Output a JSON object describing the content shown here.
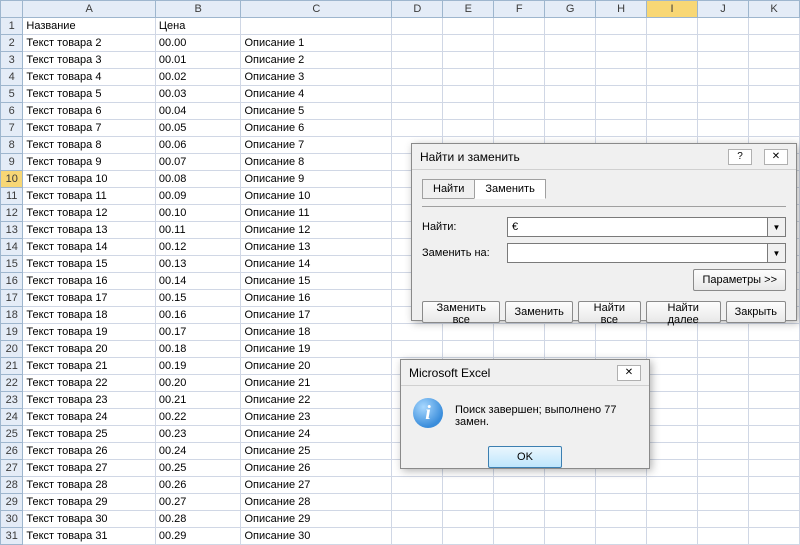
{
  "columns": [
    "A",
    "B",
    "C",
    "D",
    "E",
    "F",
    "G",
    "H",
    "I",
    "J",
    "K"
  ],
  "headers": {
    "A": "Название",
    "B": "Цена",
    "C": ""
  },
  "rows": [
    {
      "n": 1,
      "a": "Название",
      "b": "Цена",
      "c": ""
    },
    {
      "n": 2,
      "a": "Текст товара 2",
      "b": "00.00",
      "c": "Описание 1"
    },
    {
      "n": 3,
      "a": "Текст товара 3",
      "b": "00.01",
      "c": "Описание 2"
    },
    {
      "n": 4,
      "a": "Текст товара 4",
      "b": "00.02",
      "c": "Описание 3"
    },
    {
      "n": 5,
      "a": "Текст товара 5",
      "b": "00.03",
      "c": "Описание 4"
    },
    {
      "n": 6,
      "a": "Текст товара 6",
      "b": "00.04",
      "c": "Описание 5"
    },
    {
      "n": 7,
      "a": "Текст товара 7",
      "b": "00.05",
      "c": "Описание 6"
    },
    {
      "n": 8,
      "a": "Текст товара 8",
      "b": "00.06",
      "c": "Описание 7"
    },
    {
      "n": 9,
      "a": "Текст товара 9",
      "b": "00.07",
      "c": "Описание 8"
    },
    {
      "n": 10,
      "a": "Текст товара 10",
      "b": "00.08",
      "c": "Описание 9"
    },
    {
      "n": 11,
      "a": "Текст товара 11",
      "b": "00.09",
      "c": "Описание 10"
    },
    {
      "n": 12,
      "a": "Текст товара 12",
      "b": "00.10",
      "c": "Описание 11"
    },
    {
      "n": 13,
      "a": "Текст товара 13",
      "b": "00.11",
      "c": "Описание 12"
    },
    {
      "n": 14,
      "a": "Текст товара 14",
      "b": "00.12",
      "c": "Описание 13"
    },
    {
      "n": 15,
      "a": "Текст товара 15",
      "b": "00.13",
      "c": "Описание 14"
    },
    {
      "n": 16,
      "a": "Текст товара 16",
      "b": "00.14",
      "c": "Описание 15"
    },
    {
      "n": 17,
      "a": "Текст товара 17",
      "b": "00.15",
      "c": "Описание 16"
    },
    {
      "n": 18,
      "a": "Текст товара 18",
      "b": "00.16",
      "c": "Описание 17"
    },
    {
      "n": 19,
      "a": "Текст товара 19",
      "b": "00.17",
      "c": "Описание 18"
    },
    {
      "n": 20,
      "a": "Текст товара 20",
      "b": "00.18",
      "c": "Описание 19"
    },
    {
      "n": 21,
      "a": "Текст товара 21",
      "b": "00.19",
      "c": "Описание 20"
    },
    {
      "n": 22,
      "a": "Текст товара 22",
      "b": "00.20",
      "c": "Описание 21"
    },
    {
      "n": 23,
      "a": "Текст товара 23",
      "b": "00.21",
      "c": "Описание 22"
    },
    {
      "n": 24,
      "a": "Текст товара 24",
      "b": "00.22",
      "c": "Описание 23"
    },
    {
      "n": 25,
      "a": "Текст товара 25",
      "b": "00.23",
      "c": "Описание 24"
    },
    {
      "n": 26,
      "a": "Текст товара 26",
      "b": "00.24",
      "c": "Описание 25"
    },
    {
      "n": 27,
      "a": "Текст товара 27",
      "b": "00.25",
      "c": "Описание 26"
    },
    {
      "n": 28,
      "a": "Текст товара 28",
      "b": "00.26",
      "c": "Описание 27"
    },
    {
      "n": 29,
      "a": "Текст товара 29",
      "b": "00.27",
      "c": "Описание 28"
    },
    {
      "n": 30,
      "a": "Текст товара 30",
      "b": "00.28",
      "c": "Описание 29"
    },
    {
      "n": 31,
      "a": "Текст товара 31",
      "b": "00.29",
      "c": "Описание 30"
    }
  ],
  "highlighted_row": 10,
  "find_replace": {
    "title": "Найти и заменить",
    "help_icon": "?",
    "close_icon": "✕",
    "tab_find": "Найти",
    "tab_replace": "Заменить",
    "find_label": "Найти:",
    "find_value": "€",
    "replace_label": "Заменить на:",
    "replace_value": "",
    "params_btn": "Параметры >>",
    "replace_all_btn": "Заменить все",
    "replace_btn": "Заменить",
    "find_all_btn": "Найти все",
    "find_next_btn": "Найти далее",
    "close_btn": "Закрыть",
    "dropdown_icon": "▼"
  },
  "message": {
    "title": "Microsoft Excel",
    "close_icon": "✕",
    "icon_char": "i",
    "text": "Поиск завершен; выполнено 77 замен.",
    "ok_btn": "OK"
  }
}
